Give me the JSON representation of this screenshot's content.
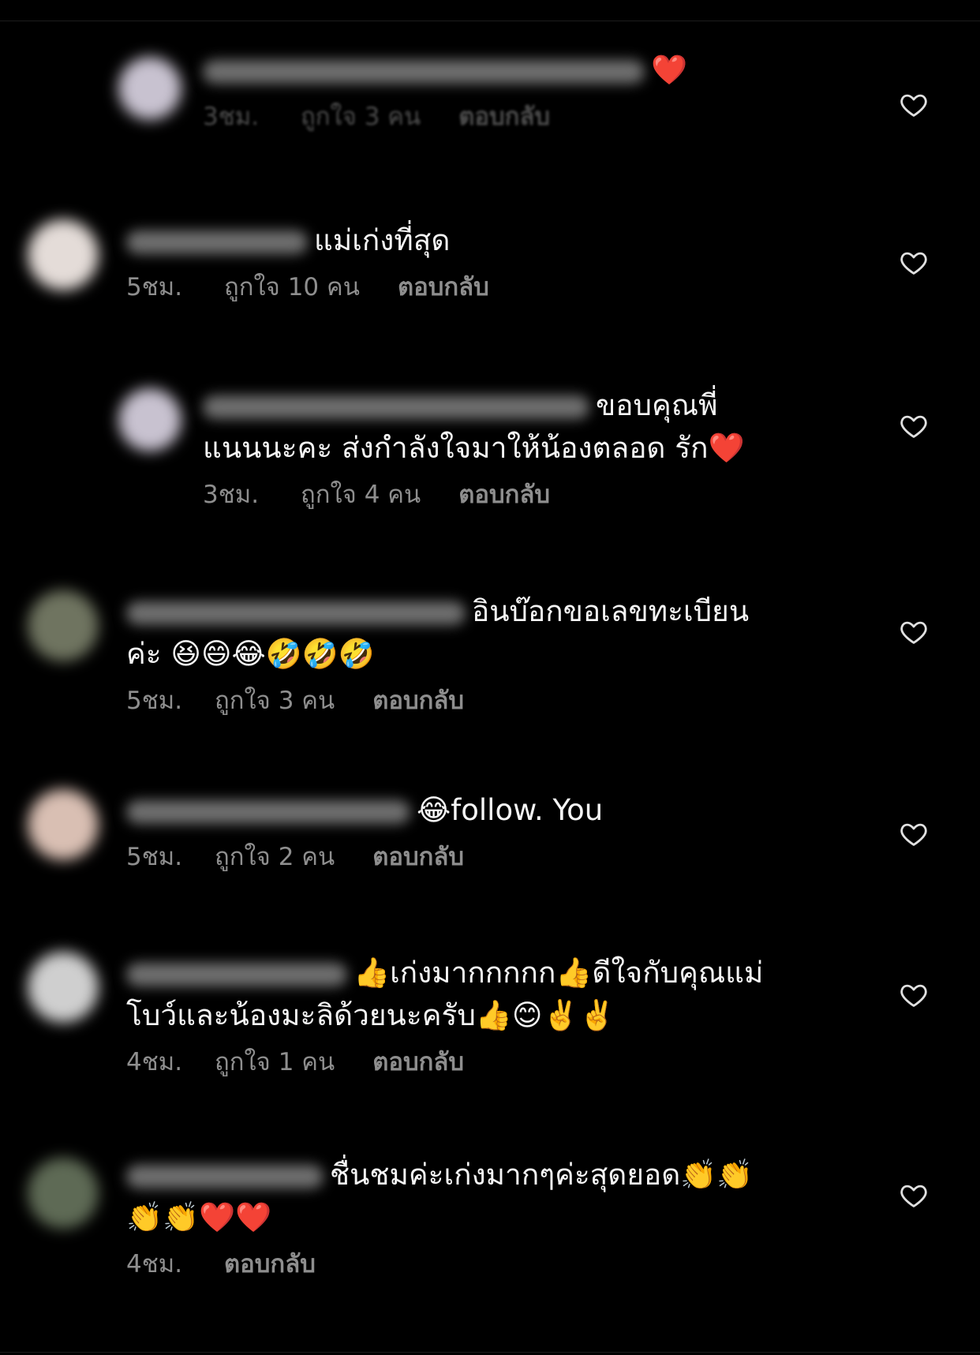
{
  "comments": [
    {
      "text": "❤️",
      "time": "3ชม.",
      "likes": "ถูกใจ 3 คน",
      "reply": "ตอบกลับ",
      "avatar_color": "#c8c2d0"
    },
    {
      "text": "แม่เก่งที่สุด",
      "time": "5ชม.",
      "likes": "ถูกใจ 10 คน",
      "reply": "ตอบกลับ",
      "avatar_color": "#e4dcd8"
    },
    {
      "text": "ขอบคุณพี่แนนนะคะ ส่งกำลังใจมาให้น้องตลอด รัก❤️",
      "time": "3ชม.",
      "likes": "ถูกใจ 4 คน",
      "reply": "ตอบกลับ",
      "avatar_color": "#c8c2d0"
    },
    {
      "text": "อินบ๊อกขอเลขทะเบียนค่ะ 😆😄😂🤣🤣🤣",
      "time": "5ชม.",
      "likes": "ถูกใจ 3 คน",
      "reply": "ตอบกลับ",
      "avatar_color": "#6f7460"
    },
    {
      "text": "😂follow. You",
      "time": "5ชม.",
      "likes": "ถูกใจ 2 คน",
      "reply": "ตอบกลับ",
      "avatar_color": "#d9bfb3"
    },
    {
      "text": "👍เก่งมากกกกก👍ดีใจกับคุณแม่โบว์และน้องมะลิด้วยนะครับ👍😊✌️✌️",
      "time": "4ชม.",
      "likes": "ถูกใจ 1 คน",
      "reply": "ตอบกลับ",
      "avatar_color": "#cfcfcf"
    },
    {
      "text": "ชื่นชมค่ะเก่งมากๆค่ะสุดยอด👏👏👏👏❤️❤️",
      "time": "4ชม.",
      "likes": "",
      "reply": "ตอบกลับ",
      "avatar_color": "#5e6a55"
    }
  ],
  "icons": {
    "like": "heart-outline-icon"
  }
}
